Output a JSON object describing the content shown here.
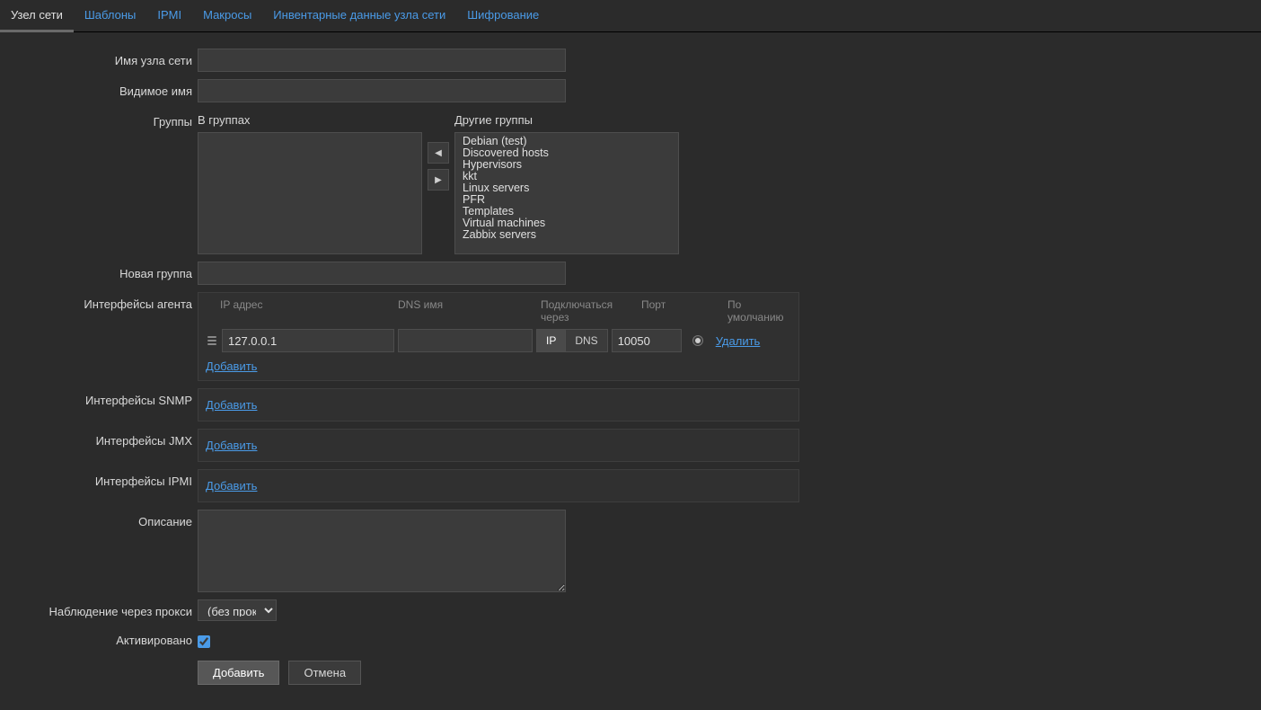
{
  "tabs": {
    "host": "Узел сети",
    "templates": "Шаблоны",
    "ipmi": "IPMI",
    "macros": "Макросы",
    "inventory": "Инвентарные данные узла сети",
    "encryption": "Шифрование"
  },
  "labels": {
    "hostname": "Имя узла сети",
    "visible_name": "Видимое имя",
    "groups": "Группы",
    "in_groups": "В группах",
    "other_groups": "Другие группы",
    "new_group": "Новая группа",
    "agent_ifaces": "Интерфейсы агента",
    "snmp_ifaces": "Интерфейсы SNMP",
    "jmx_ifaces": "Интерфейсы JMX",
    "ipmi_ifaces": "Интерфейсы IPMI",
    "description": "Описание",
    "proxy": "Наблюдение через прокси",
    "enabled": "Активировано"
  },
  "iface_headers": {
    "ip": "IP адрес",
    "dns": "DNS имя",
    "connect": "Подключаться через",
    "port": "Порт",
    "default": "По умолчанию"
  },
  "agent_row": {
    "ip": "127.0.0.1",
    "dns": "",
    "seg_ip": "IP",
    "seg_dns": "DNS",
    "port": "10050"
  },
  "actions": {
    "add_link": "Добавить",
    "remove_link": "Удалить",
    "add_btn": "Добавить",
    "cancel_btn": "Отмена"
  },
  "proxy": {
    "selected": "(без прокси)"
  },
  "other_groups": [
    "Debian (test)",
    "Discovered hosts",
    "Hypervisors",
    "kkt",
    "Linux servers",
    "PFR",
    "Templates",
    "Virtual machines",
    "Zabbix servers"
  ]
}
